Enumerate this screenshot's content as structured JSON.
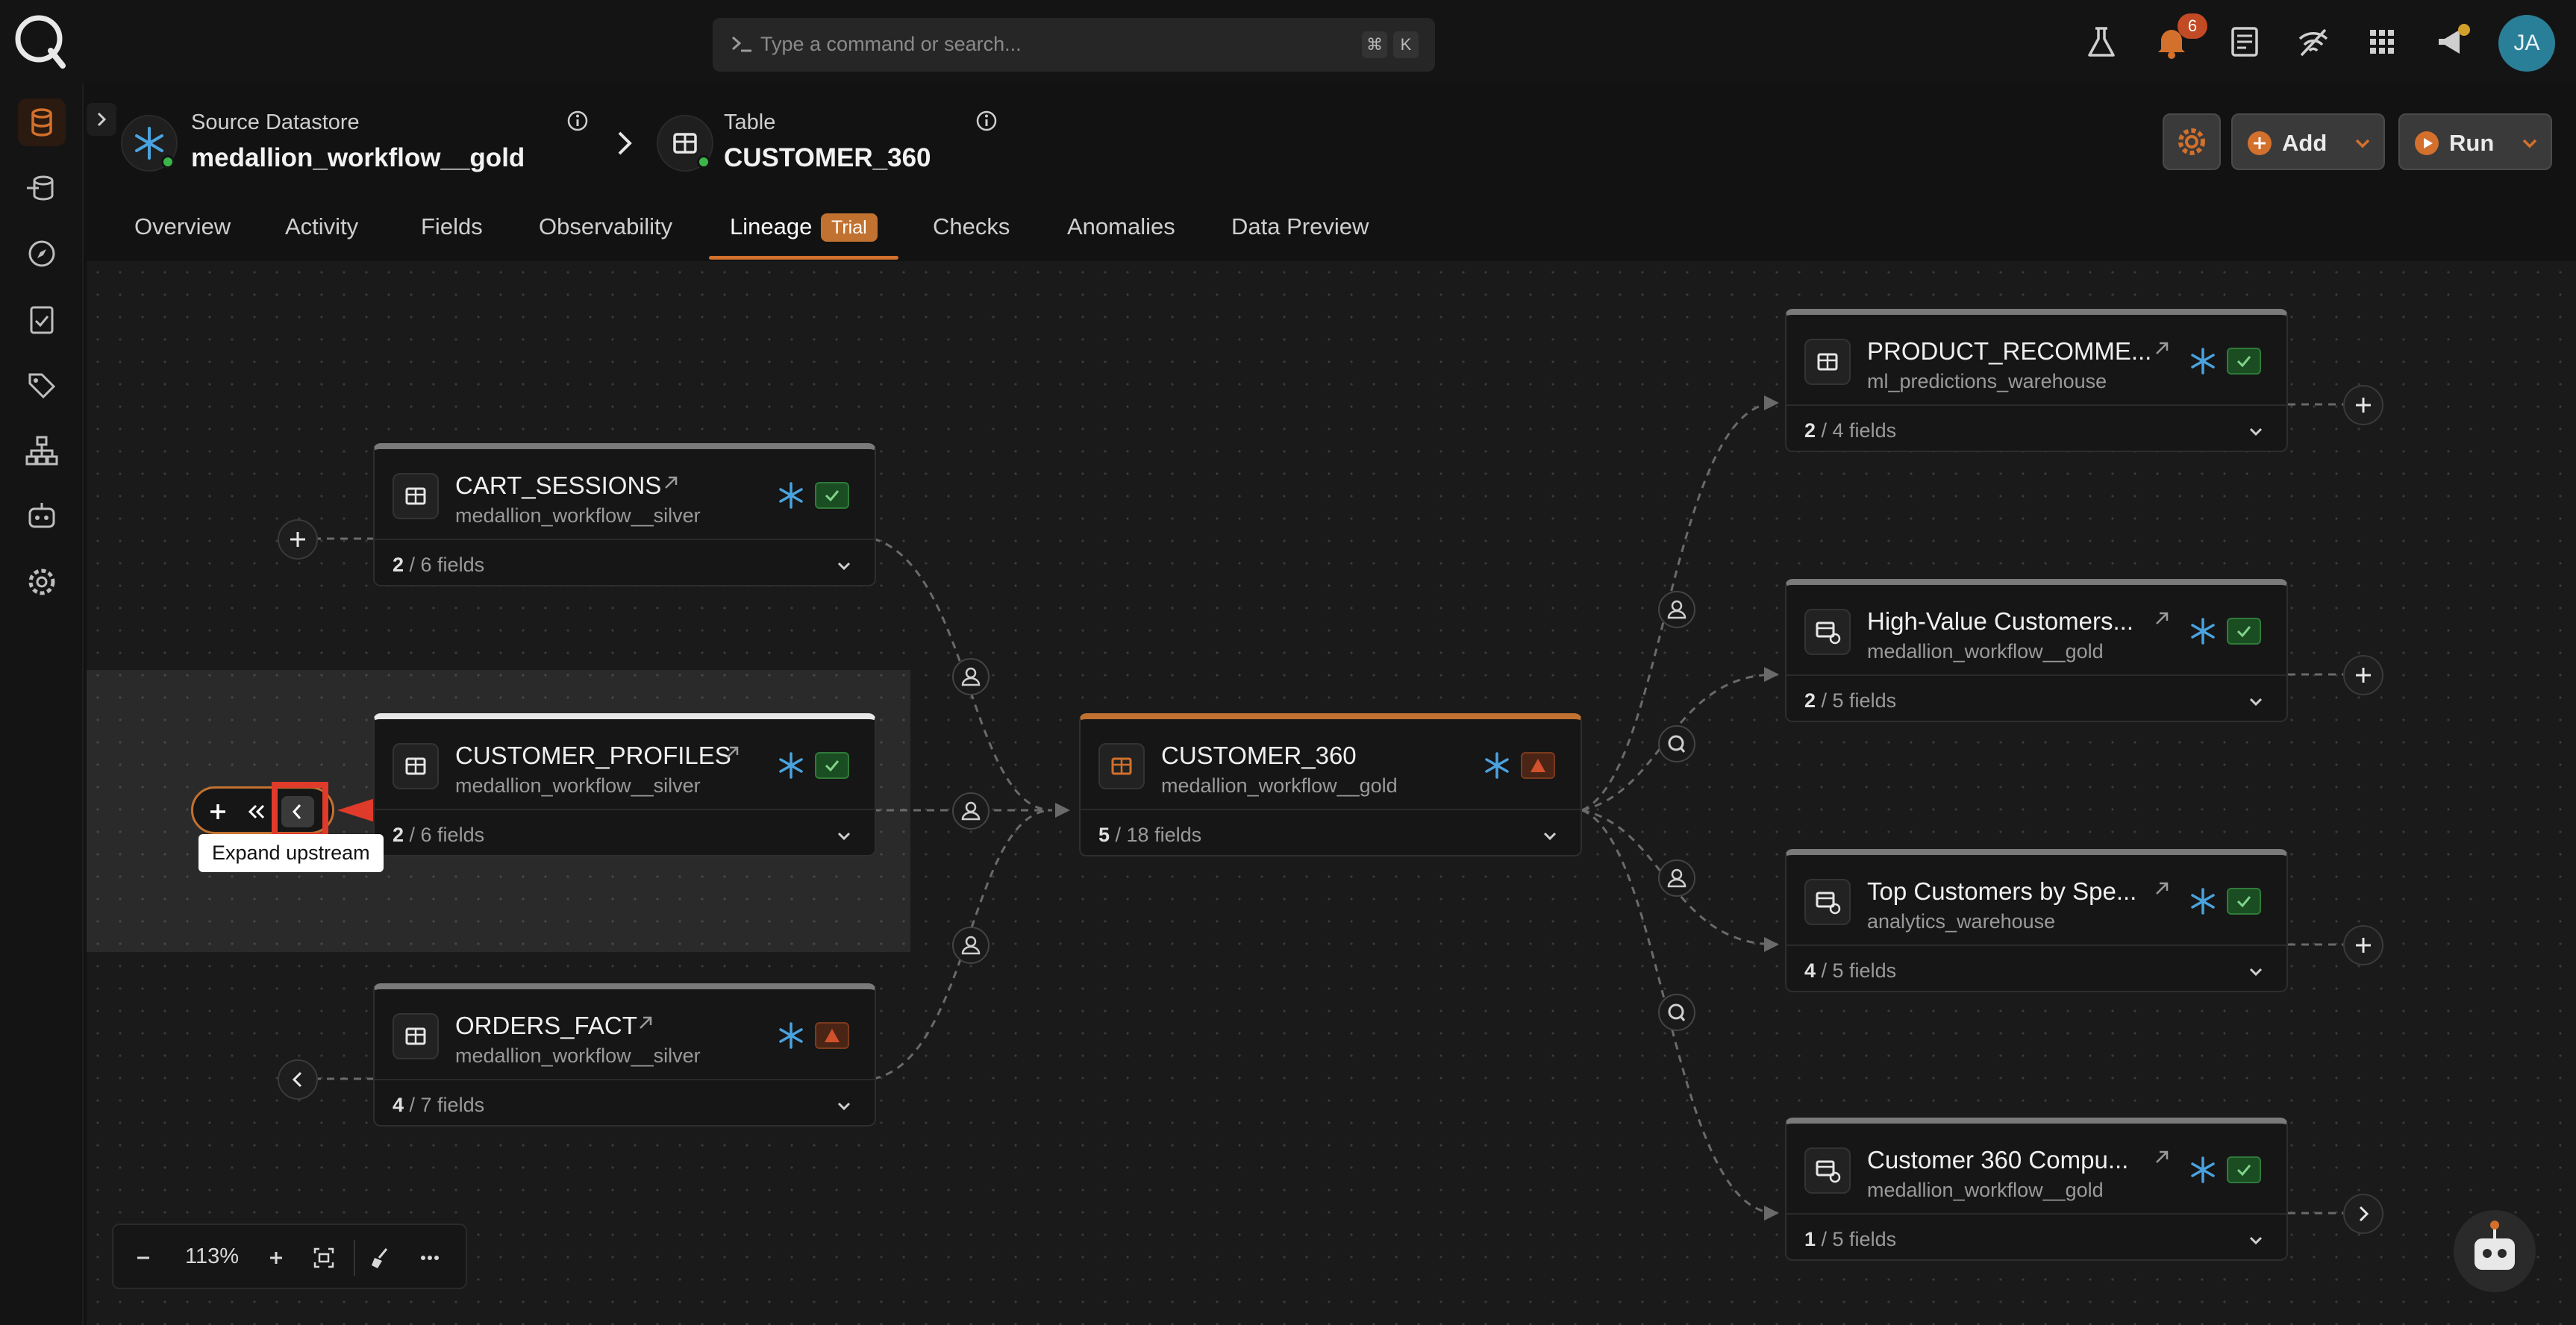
{
  "command_bar": {
    "placeholder": "Type a command or search...",
    "shortcut_keys": [
      "⌘",
      "K"
    ]
  },
  "notifications": {
    "count": "6"
  },
  "user": {
    "initials": "JA"
  },
  "sidebar_icons": [
    "datastores-icon",
    "sources-icon",
    "explore-icon",
    "checks-icon",
    "tags-icon",
    "hierarchy-icon",
    "agent-icon",
    "settings-icon"
  ],
  "header": {
    "source_label": "Source Datastore",
    "source_name": "medallion_workflow__gold",
    "table_label": "Table",
    "table_name": "CUSTOMER_360",
    "add_label": "Add",
    "run_label": "Run"
  },
  "tabs": {
    "overview": "Overview",
    "activity": "Activity",
    "fields": "Fields",
    "observability": "Observability",
    "lineage": "Lineage",
    "lineage_badge": "Trial",
    "checks": "Checks",
    "anomalies": "Anomalies",
    "data_preview": "Data Preview",
    "active": "Lineage"
  },
  "lineage": {
    "upstream": [
      {
        "title": "CART_SESSIONS",
        "datastore": "medallion_workflow__silver",
        "fields_shown": "2",
        "fields_total": " / 6 fields",
        "status": "ok"
      },
      {
        "title": "CUSTOMER_PROFILES",
        "datastore": "medallion_workflow__silver",
        "fields_shown": "2",
        "fields_total": " / 6 fields",
        "status": "ok"
      },
      {
        "title": "ORDERS_FACT",
        "datastore": "medallion_workflow__silver",
        "fields_shown": "4",
        "fields_total": " / 7 fields",
        "status": "warning"
      }
    ],
    "center": {
      "title": "CUSTOMER_360",
      "datastore": "medallion_workflow__gold",
      "fields_shown": "5",
      "fields_total": " / 18 fields",
      "status": "warning"
    },
    "downstream": [
      {
        "title": "PRODUCT_RECOMME...",
        "datastore": "ml_predictions_warehouse",
        "fields_shown": "2",
        "fields_total": " / 4 fields",
        "status": "ok"
      },
      {
        "title": "High-Value Customers...",
        "datastore": "medallion_workflow__gold",
        "fields_shown": "2",
        "fields_total": " / 5 fields",
        "status": "ok"
      },
      {
        "title": "Top Customers by Spe...",
        "datastore": "analytics_warehouse",
        "fields_shown": "4",
        "fields_total": " / 5 fields",
        "status": "ok"
      },
      {
        "title": "Customer 360 Compu...",
        "datastore": "medallion_workflow__gold",
        "fields_shown": "1",
        "fields_total": " / 5 fields",
        "status": "ok"
      }
    ],
    "tooltip": "Expand upstream"
  },
  "zoom": {
    "level": "113%"
  },
  "colors": {
    "accent": "#c27230",
    "ok": "#2f7a3a",
    "warning": "#d2502c",
    "snowflake": "#4aa3df",
    "annotation": "#e03a2a"
  }
}
